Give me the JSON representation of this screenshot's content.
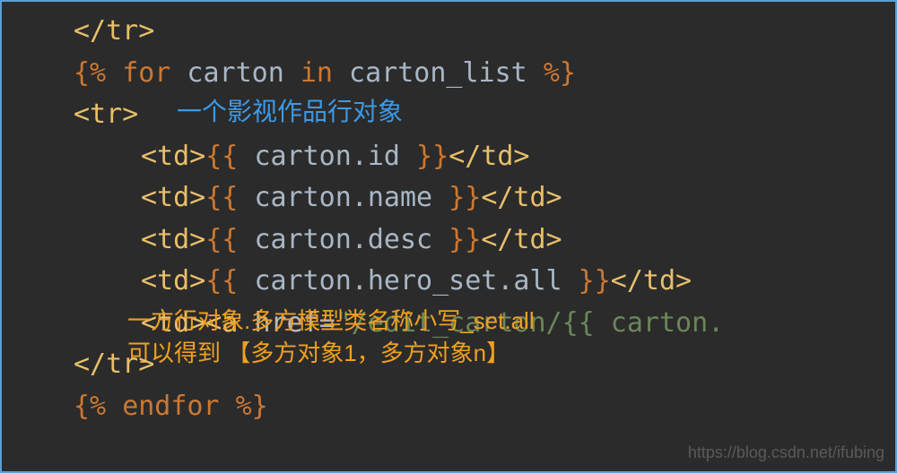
{
  "code": {
    "line1_close_tr": "</tr>",
    "line2_open": "{% ",
    "line2_for": "for",
    "line2_var": " carton ",
    "line2_in": "in",
    "line2_list": " carton_list ",
    "line2_close": "%}",
    "line3_tr": "<tr>",
    "td_open": "<td>",
    "td_close": "</td>",
    "expr_open": "{{ ",
    "expr_close": " }}",
    "expr1": "carton.id",
    "expr2": "carton.name",
    "expr3": "carton.desc",
    "expr4": "carton.hero_set.all",
    "line8_a": "<a ",
    "line8_href": "href",
    "line8_eq": "=",
    "line8_url": "\"/edit_carton/{{ carton.",
    "line9_close_tr": "</tr>",
    "line10_open": "{% ",
    "line10_endfor": "endfor",
    "line10_close": " %}"
  },
  "annotations": {
    "blue1": "一个影视作品行对象",
    "orange1": "一方行对象.多方模型类名称小写_set.all",
    "orange2": "可以得到  【多方对象1，多方对象n】"
  },
  "watermark": "https://blog.csdn.net/ifubing"
}
